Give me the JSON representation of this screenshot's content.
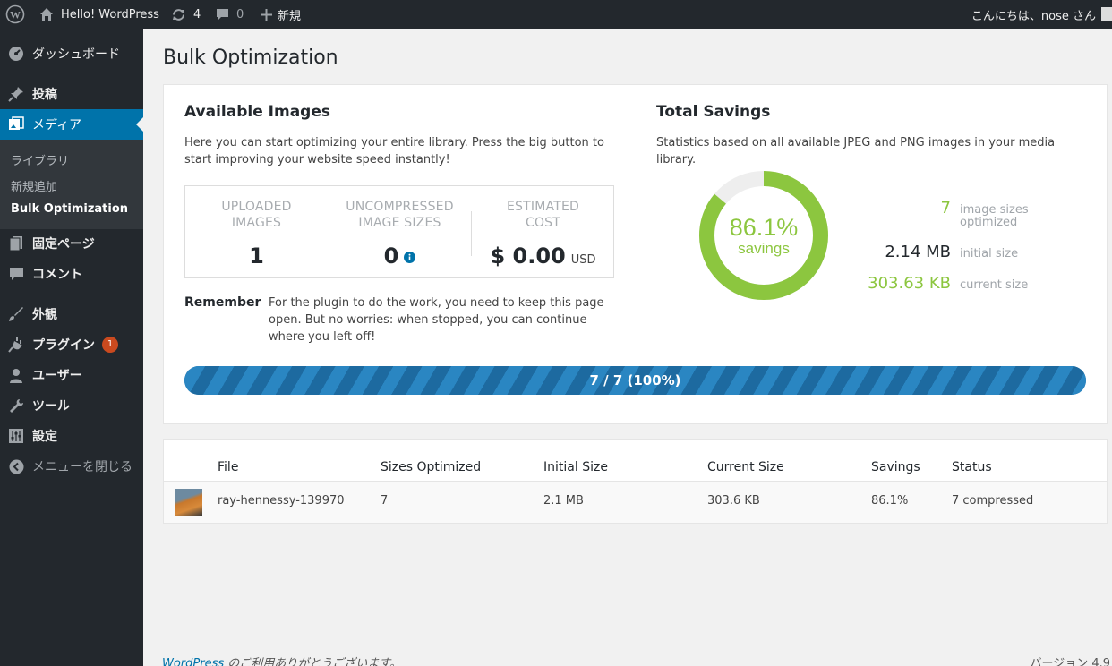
{
  "admin_bar": {
    "site_name": "Hello! WordPress",
    "updates_count": "4",
    "comments_count": "0",
    "new_label": "新規",
    "greeting": "こんにちは、nose さん"
  },
  "sidebar": {
    "dashboard": "ダッシュボード",
    "posts": "投稿",
    "media": "メディア",
    "submenu": [
      "ライブラリ",
      "新規追加",
      "Bulk Optimization"
    ],
    "pages": "固定ページ",
    "comments": "コメント",
    "appearance": "外観",
    "plugins": "プラグイン",
    "plugins_badge": "1",
    "users": "ユーザー",
    "tools": "ツール",
    "settings": "設定",
    "collapse": "メニューを閉じる"
  },
  "page_title": "Bulk Optimization",
  "available": {
    "title": "Available Images",
    "description": "Here you can start optimizing your entire library. Press the big button to start improving your website speed instantly!",
    "stats": [
      {
        "label": "UPLOADED IMAGES",
        "value": "1"
      },
      {
        "label": "UNCOMPRESSED IMAGE SIZES",
        "value": "0"
      },
      {
        "label": "ESTIMATED COST",
        "value": "$ 0.00",
        "unit": "USD"
      }
    ],
    "remember_label": "Remember",
    "remember_text": "For the plugin to do the work, you need to keep this page open. But no worries: when stopped, you can continue where you left off!"
  },
  "savings": {
    "title": "Total Savings",
    "description": "Statistics based on all available JPEG and PNG images in your media library.",
    "percent_label": "86.1%",
    "percent_value": 0.861,
    "savings_label": "savings",
    "items": [
      {
        "value": "7",
        "label": "image sizes optimized",
        "color": "#8cc63f"
      },
      {
        "value": "2.14 MB",
        "label": "initial size",
        "color": "#23282d"
      },
      {
        "value": "303.63 KB",
        "label": "current size",
        "color": "#8cc63f"
      }
    ]
  },
  "progress": {
    "label": "7 / 7 (100%)",
    "fraction": 1.0
  },
  "table": {
    "headers": [
      "File",
      "Sizes Optimized",
      "Initial Size",
      "Current Size",
      "Savings",
      "Status"
    ],
    "rows": [
      [
        "ray-hennessy-139970",
        "7",
        "2.1 MB",
        "303.6 KB",
        "86.1%",
        "7 compressed"
      ]
    ]
  },
  "footer": {
    "link": "WordPress",
    "thanks": " のご利用ありがとうございます。",
    "version": "バージョン 4.9"
  },
  "colors": {
    "accent": "#0073aa",
    "green": "#8cc63f",
    "progress": "#2a86c2",
    "sidebar": "#23282d"
  }
}
